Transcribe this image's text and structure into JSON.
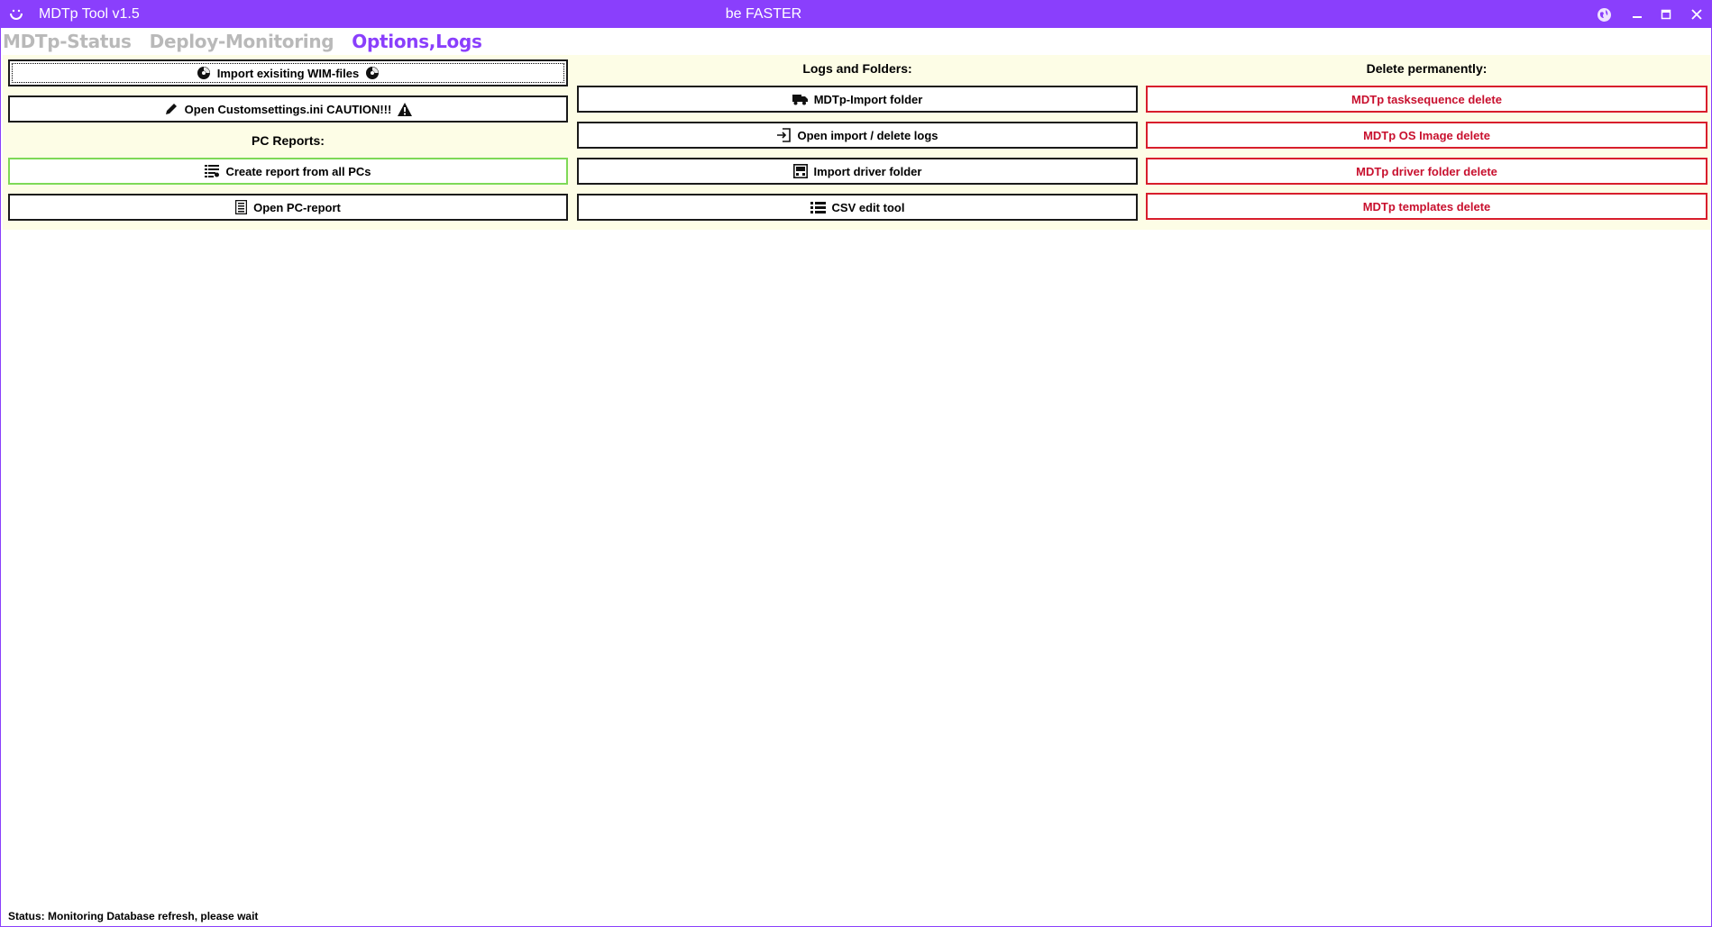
{
  "window": {
    "title": "MDTp Tool v1.5",
    "center_title": "be FASTER",
    "accent_color": "#8a3ffc",
    "icons": {
      "app": "smiley-icon",
      "globe": "globe-icon",
      "minimize": "minimize-icon",
      "maximize": "maximize-icon",
      "close": "close-icon"
    }
  },
  "tabs": [
    {
      "label": "MDTp-Status",
      "active": false
    },
    {
      "label": "Deploy-Monitoring",
      "active": false
    },
    {
      "label": "Options,Logs",
      "active": true
    }
  ],
  "left_column": {
    "import_wim_label": "Import exisiting WIM-files",
    "open_customsettings_label": "Open Customsettings.ini CAUTION!!!",
    "pc_reports_heading": "PC Reports:",
    "create_report_label": "Create report from all PCs",
    "open_pc_report_label": "Open PC-report"
  },
  "middle_column": {
    "heading": "Logs and Folders:",
    "import_folder_label": "MDTp-Import folder",
    "open_logs_label": "Open import / delete logs",
    "driver_folder_label": "Import driver folder",
    "csv_edit_label": "CSV edit tool"
  },
  "right_column": {
    "heading": "Delete permanently:",
    "tasksequence_delete_label": "MDTp tasksequence delete",
    "os_image_delete_label": "MDTp OS Image delete",
    "driver_folder_delete_label": "MDTp driver folder delete",
    "templates_delete_label": "MDTp templates delete",
    "danger_color": "#c8102e"
  },
  "status": {
    "text": "Status: Monitoring Database refresh, please wait"
  }
}
